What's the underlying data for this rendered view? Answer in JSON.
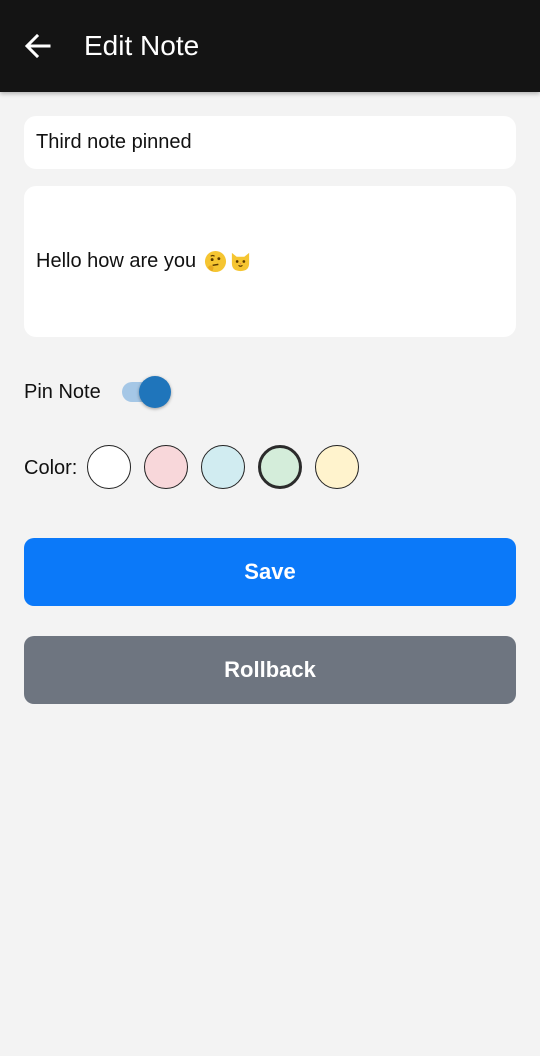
{
  "app_bar": {
    "title": "Edit Note",
    "back_icon": "arrow-left-icon"
  },
  "form": {
    "title_value": "Third note pinned",
    "content_text": "Hello how are you",
    "content_emojis": [
      "🤔",
      "🐱"
    ],
    "pin_label": "Pin Note",
    "pin_enabled": true,
    "color_label": "Color:",
    "colors": [
      {
        "hex": "#ffffff",
        "selected": false
      },
      {
        "hex": "#f8d7da",
        "selected": false
      },
      {
        "hex": "#d1ecf1",
        "selected": false
      },
      {
        "hex": "#d4edda",
        "selected": true
      },
      {
        "hex": "#fff3cd",
        "selected": false
      }
    ]
  },
  "actions": {
    "save_label": "Save",
    "rollback_label": "Rollback"
  },
  "theme": {
    "app_bar_bg": "#141414",
    "background": "#f3f3f3",
    "save_color": "#0b79f9",
    "rollback_color": "#6e7580",
    "switch_thumb": "#1f75bb",
    "switch_track": "#a5c7e6"
  }
}
